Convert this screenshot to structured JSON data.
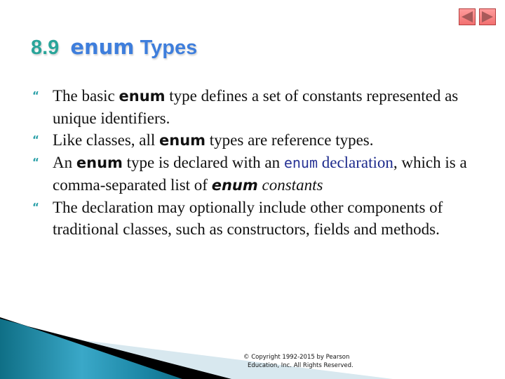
{
  "title": {
    "number": "8.9",
    "keyword": "enum",
    "rest": "Types"
  },
  "nav": {
    "prev_icon": "triangle-left-icon",
    "next_icon": "triangle-right-icon"
  },
  "bullet_glyph": "“",
  "bullets": [
    {
      "p1": "The basic ",
      "code": "enum",
      "p2": " type defines a set of constants represented as unique identifiers."
    },
    {
      "p1": "Like classes, all ",
      "code": "enum",
      "p2": " types are reference types."
    },
    {
      "p1": "An ",
      "code": "enum",
      "p2": " type is declared with an ",
      "code_blue": "enum",
      "blue": " declaration",
      "p3": ", which is a comma-separated list of ",
      "ital_code": "enum",
      "ital": " constants"
    },
    {
      "p1": "The declaration may optionally include other components of traditional classes, such as constructors, fields and methods."
    }
  ],
  "copyright": {
    "line1": "© Copyright 1992-2015 by Pearson",
    "line2": "Education, Inc. All Rights Reserved."
  },
  "colors": {
    "title_number": "#2aa59a",
    "title_text": "#3e7edc",
    "bullet": "#2aa0a8",
    "keyword_blue": "#1c2a8c",
    "nav_button": "#f58080"
  }
}
